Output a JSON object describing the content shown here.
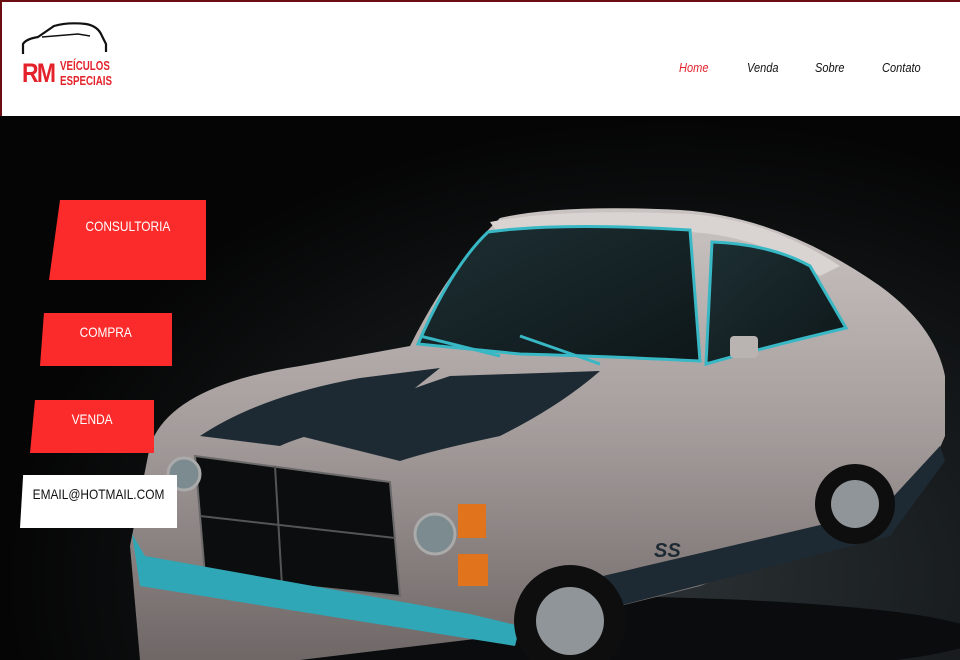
{
  "brand": {
    "initials": "RM",
    "line1": "VEÍCULOS",
    "line2": "ESPECIAIS",
    "color": "#e3222b"
  },
  "nav": [
    {
      "label": "Home",
      "active": true
    },
    {
      "label": "Venda",
      "active": false
    },
    {
      "label": "Sobre",
      "active": false
    },
    {
      "label": "Contato",
      "active": false
    }
  ],
  "side_buttons": [
    {
      "label": "CONSULTORIA"
    },
    {
      "label": "COMPRA"
    },
    {
      "label": "VENDA"
    }
  ],
  "email": {
    "label": "EMAIL@HOTMAIL.COM"
  },
  "hero": {
    "car_badge": "SS"
  },
  "colors": {
    "accent": "#fb2b2b",
    "header_bg": "#ffffff",
    "hero_bg": "#000000"
  }
}
